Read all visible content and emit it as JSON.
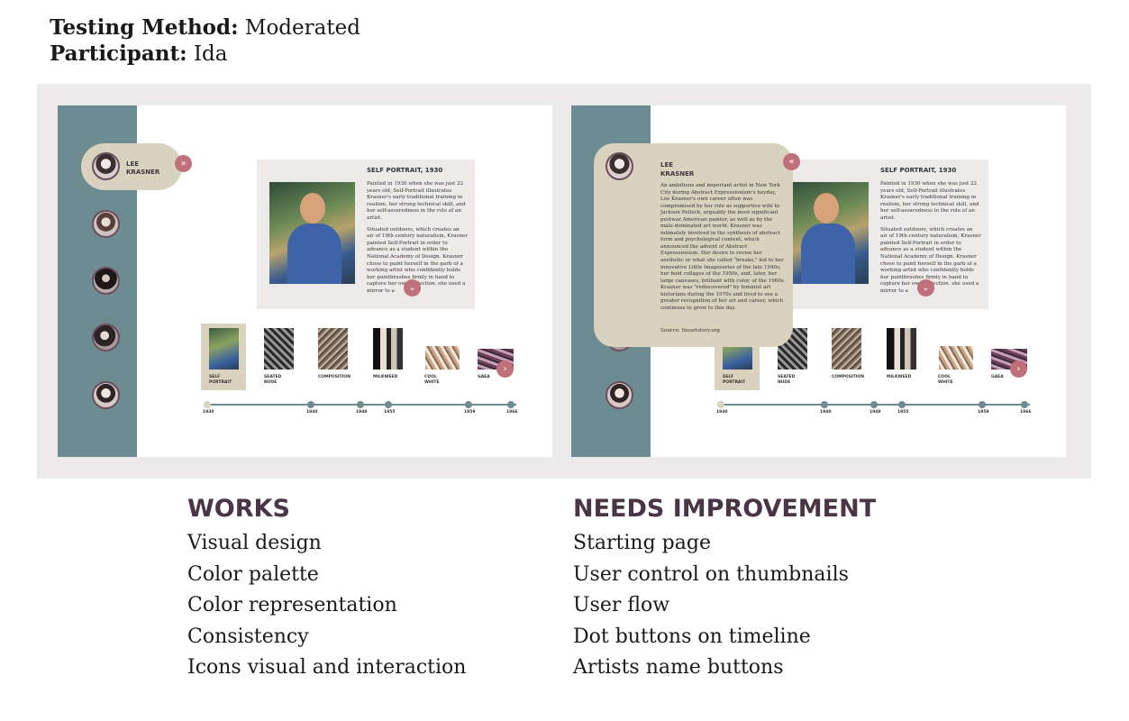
{
  "header": {
    "method_label": "Testing Method:",
    "method_value": "Moderated",
    "participant_label": "Participant:",
    "participant_value": "Ida"
  },
  "prototype": {
    "artist_name": "LEE\nKRASNER",
    "expand_icon": "double-chevron-right-icon",
    "collapse_icon": "double-chevron-left-icon",
    "card": {
      "title": "SELF PORTRAIT, 1930",
      "para1": "Painted in 1930 when she was just 22 years old, Self-Portrait illustrates Krasner's early traditional training in realism, her strong technical skill, and her self-assuredness in the role of an artist.",
      "para2": "Situated outdoors, which creates an air of 19th-century naturalism, Krasner painted Self-Portrait in order to advance as a student within the National Academy of Design. Krasner chose to paint herself in the garb of a working artist who confidently holds her paintbrushes firmly in hand to capture her own reflection. she used a mirror to a"
    },
    "thumbnails": [
      {
        "label": "SELF\nPORTRAIT"
      },
      {
        "label": "SEATED\nNUDE"
      },
      {
        "label": "COMPOSITION"
      },
      {
        "label": "MILKWEED"
      },
      {
        "label": "COOL\nWHITE"
      },
      {
        "label": "GAEA"
      }
    ],
    "timeline_years": [
      "1930",
      "1940",
      "1949",
      "1955",
      "1959",
      "1966"
    ],
    "bio": {
      "text": "An ambitious and important artist in New York City during Abstract Expressionism's heyday, Lee Krasner's own career often was compromised by her role as supportive wife to Jackson Pollock, arguably the most significant postwar American painter, as well as by the male-dominated art world. Krasner was intimately involved in the synthesis of abstract form and psychological content, which announced the advent of Abstract Expressionism. Her desire to revise her aesthetic or what she called \"breaks,\" led to her innovative Little Imageseries of the late 1940s, her bold collages of the 1950s, and, later, her large canvases, brilliant with color, of the 1960s. Krasner was \"rediscovered\" by feminist art historians during the 1970s and lived to see a greater recognition of her art and career, which continues to grow to this day.",
      "source": "Source: theartstory.org"
    }
  },
  "works": {
    "heading": "WORKS",
    "items": [
      "Visual design",
      "Color palette",
      "Color representation",
      "Consistency",
      "Icons visual and interaction"
    ]
  },
  "needs_improvement": {
    "heading": "NEEDS IMPROVEMENT",
    "items": [
      "Starting page",
      "User control on thumbnails",
      "User flow",
      "Dot buttons on timeline",
      "Artists name buttons"
    ]
  },
  "colors": {
    "sidebar_teal": "#6d8c91",
    "accent_rose": "#c0707a",
    "panel_beige": "#d8d2bf",
    "heading_plum": "#4a3546"
  }
}
